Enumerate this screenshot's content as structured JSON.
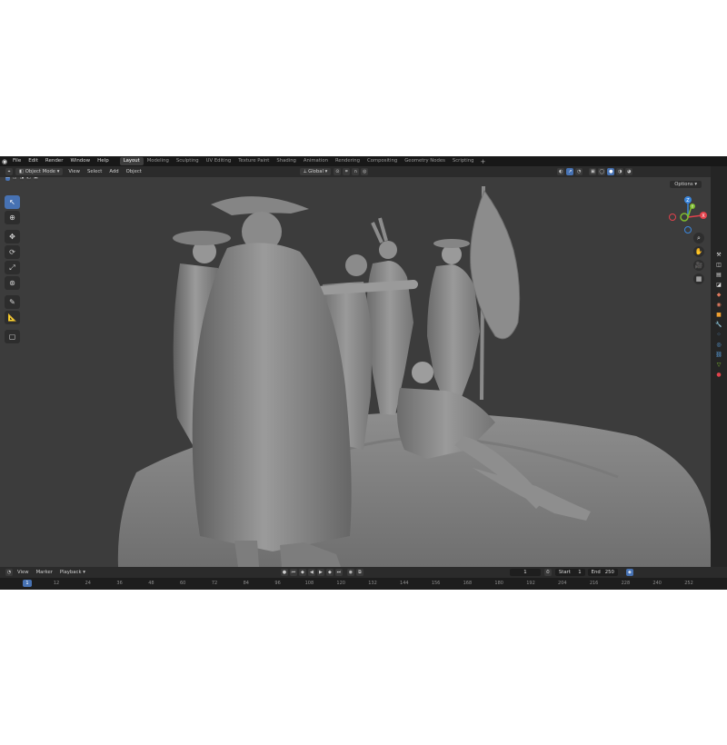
{
  "menu": [
    "File",
    "Edit",
    "Render",
    "Window",
    "Help"
  ],
  "workspaces": [
    "Layout",
    "Modeling",
    "Sculpting",
    "UV Editing",
    "Texture Paint",
    "Shading",
    "Animation",
    "Rendering",
    "Compositing",
    "Geometry Nodes",
    "Scripting"
  ],
  "active_workspace": "Layout",
  "viewport_header": {
    "mode": "Object Mode",
    "items": [
      "View",
      "Select",
      "Add",
      "Object"
    ],
    "transform_orientation": "Global",
    "options": "Options"
  },
  "gizmo": {
    "x": "X",
    "y": "Y",
    "z": "Z"
  },
  "timeline": {
    "mode_items": [
      "View",
      "Marker"
    ],
    "playback": "Playback",
    "current_frame": "1",
    "start_label": "Start",
    "start": "1",
    "end_label": "End",
    "end": "250",
    "ticks": [
      "1",
      "12",
      "24",
      "36",
      "48",
      "60",
      "72",
      "84",
      "96",
      "108",
      "120",
      "132",
      "144",
      "156",
      "168",
      "180",
      "192",
      "204",
      "216",
      "228",
      "240",
      "252"
    ]
  },
  "colors": {
    "accent": "#4772b3",
    "x_axis": "#e2424c",
    "y_axis": "#7fbd2f",
    "z_axis": "#3b86db"
  }
}
